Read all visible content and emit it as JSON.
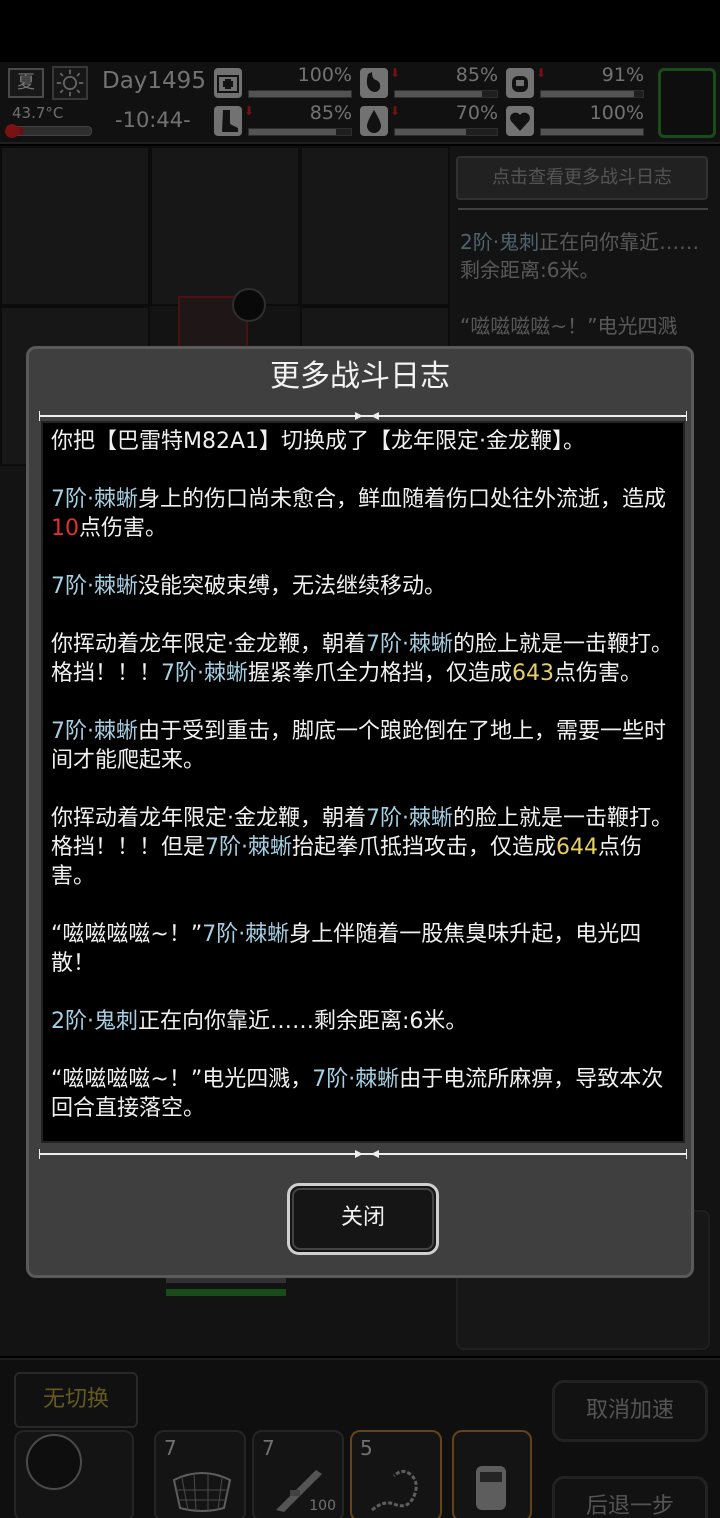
{
  "status_bar": {
    "season": "夏",
    "temperature": "43.7°C",
    "day": "Day1495",
    "time": "-10:44-",
    "stats": [
      {
        "icon": "medkit-icon",
        "value": "100%",
        "level": 1.0,
        "down": false
      },
      {
        "icon": "stomach-icon",
        "value": "85%",
        "level": 0.85,
        "down": true
      },
      {
        "icon": "mask-icon",
        "value": "91%",
        "level": 0.91,
        "down": true
      },
      {
        "icon": "boot-icon",
        "value": "85%",
        "level": 0.85,
        "down": true
      },
      {
        "icon": "water-drop-icon",
        "value": "70%",
        "level": 0.7,
        "down": true
      },
      {
        "icon": "heart-icon",
        "value": "100%",
        "level": 1.0,
        "down": false
      }
    ]
  },
  "background": {
    "log_button": "点击查看更多战斗日志",
    "log_entry_1_a": "2阶·鬼刺",
    "log_entry_1_b": "正在向你靠近……剩余距离:6米。",
    "log_entry_2": "“嗞嗞嗞嗞~！”电光四溅"
  },
  "bottom_bar": {
    "no_switch": "无切换",
    "slots": [
      {
        "count": "7",
        "icon": "net-trap-icon"
      },
      {
        "count": "7",
        "icon": "rifle-icon",
        "ammo": "100"
      },
      {
        "count": "5",
        "icon": "golden-whip-icon",
        "selected": true
      },
      {
        "count": "",
        "icon": "vehicle-icon"
      }
    ],
    "cancel_speedup": "取消加速",
    "step_back": "后退一步"
  },
  "dialog": {
    "title": "更多战斗日志",
    "close_label": "关闭",
    "log": {
      "e1": "你把【巴雷特M82A1】切换成了【龙年限定·金龙鞭】。",
      "e2_a": "7阶·棘蜥",
      "e2_b": "身上的伤口尚未愈合，鲜血随着伤口处往外流逝，造成",
      "e2_dmg": "10",
      "e2_c": "点伤害。",
      "e3_a": "7阶·棘蜥",
      "e3_b": "没能突破束缚，无法继续移动。",
      "e4_a": "你挥动着龙年限定·金龙鞭，朝着",
      "e4_b": "7阶·棘蜥",
      "e4_c": "的脸上就是一击鞭打。格挡！！！",
      "e4_d": "7阶·棘蜥",
      "e4_e": "握紧拳爪全力格挡，仅造成",
      "e4_dmg": "643",
      "e4_f": "点伤害。",
      "e5_a": "7阶·棘蜥",
      "e5_b": "由于受到重击，脚底一个踉跄倒在了地上，需要一些时间才能爬起来。",
      "e6_a": "你挥动着龙年限定·金龙鞭，朝着",
      "e6_b": "7阶·棘蜥",
      "e6_c": "的脸上就是一击鞭打。格挡！！！但是",
      "e6_d": "7阶·棘蜥",
      "e6_e": "抬起拳爪抵挡攻击，仅造成",
      "e6_dmg": "644",
      "e6_f": "点伤害。",
      "e7_a": "“嗞嗞嗞嗞~！”",
      "e7_b": "7阶·棘蜥",
      "e7_c": "身上伴随着一股焦臭味升起，电光四散！",
      "e8_a": "2阶·鬼刺",
      "e8_b": "正在向你靠近……剩余距离:6米。",
      "e9_a": "“嗞嗞嗞嗞~！”电光四溅，",
      "e9_b": "7阶·棘蜥",
      "e9_c": "由于电流所麻痹，导致本次回合直接落空。"
    }
  }
}
